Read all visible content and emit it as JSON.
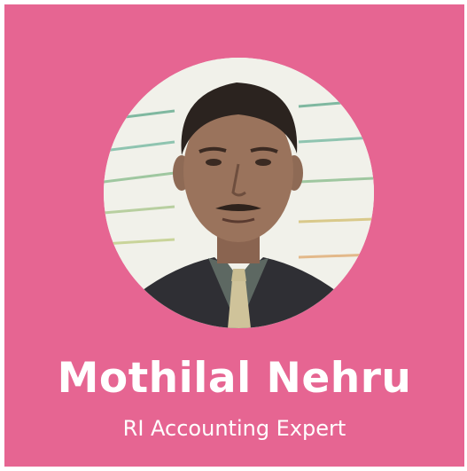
{
  "profile": {
    "name": "Mothilal Nehru",
    "title": "RI Accounting Expert",
    "photo_icon": "person-portrait"
  },
  "colors": {
    "card_background": "#e66592",
    "text": "#ffffff"
  }
}
